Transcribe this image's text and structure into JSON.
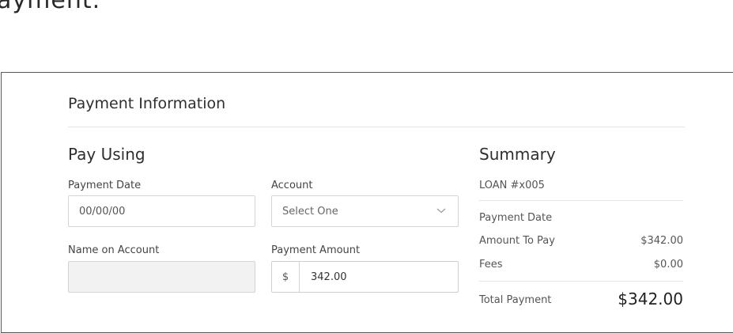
{
  "page": {
    "heading_fragment": "ayment."
  },
  "panel": {
    "title": "Payment Information"
  },
  "pay_using": {
    "heading": "Pay Using",
    "payment_date": {
      "label": "Payment Date",
      "value": "00/00/00"
    },
    "account": {
      "label": "Account",
      "selected": "Select One"
    },
    "name_on_account": {
      "label": "Name on Account",
      "value": ""
    },
    "payment_amount": {
      "label": "Payment Amount",
      "currency_symbol": "$",
      "value": "342.00"
    }
  },
  "summary": {
    "heading": "Summary",
    "loan_label": "LOAN #x005",
    "payment_date_label": "Payment Date",
    "amount_to_pay_label": "Amount To Pay",
    "amount_to_pay_value": "$342.00",
    "fees_label": "Fees",
    "fees_value": "$0.00",
    "total_label": "Total Payment",
    "total_value": "$342.00"
  }
}
